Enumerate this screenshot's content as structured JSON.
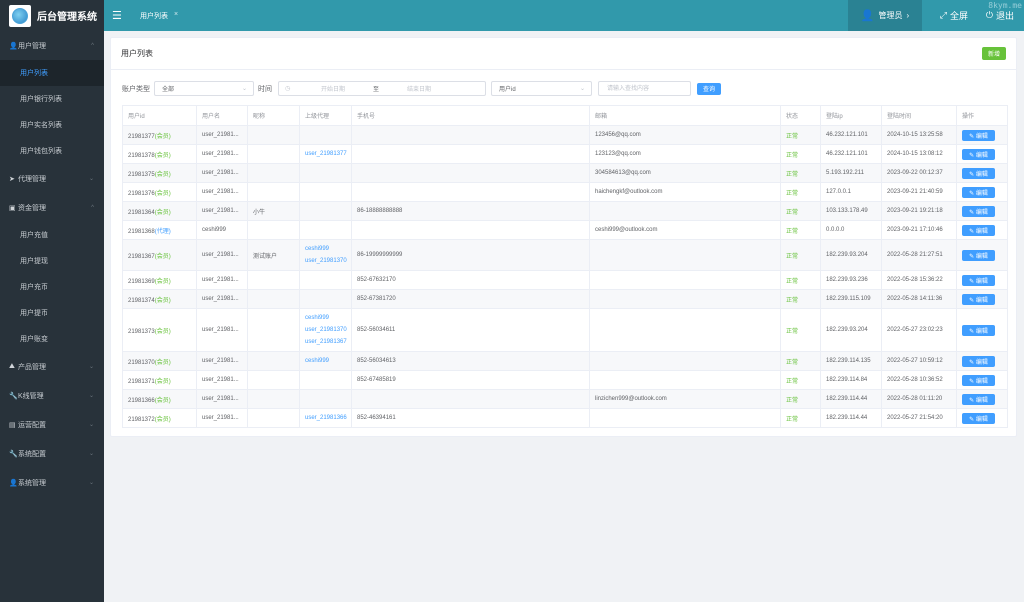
{
  "app": {
    "title": "后台管理系统",
    "watermark": "8kym.me"
  },
  "header": {
    "tab": "用户列表",
    "admin": "管理员",
    "fullscreen": "全屏",
    "logout": "退出"
  },
  "sidebar": [
    {
      "label": "用户管理",
      "icon": "user-icon",
      "expanded": true,
      "children": [
        {
          "label": "用户列表",
          "active": true
        },
        {
          "label": "用户银行列表"
        },
        {
          "label": "用户实名列表"
        },
        {
          "label": "用户钱包列表"
        }
      ]
    },
    {
      "label": "代理管理",
      "icon": "send-icon",
      "expanded": false,
      "children": []
    },
    {
      "label": "资金管理",
      "icon": "wallet-icon",
      "expanded": true,
      "children": [
        {
          "label": "用户充值"
        },
        {
          "label": "用户提现"
        },
        {
          "label": "用户充币"
        },
        {
          "label": "用户提币"
        },
        {
          "label": "用户账变"
        }
      ]
    },
    {
      "label": "产品管理",
      "icon": "chart-icon",
      "expanded": false,
      "children": []
    },
    {
      "label": "K线管理",
      "icon": "wrench-icon",
      "expanded": false,
      "children": []
    },
    {
      "label": "运营配置",
      "icon": "doc-icon",
      "expanded": false,
      "children": []
    },
    {
      "label": "系统配置",
      "icon": "wrench-icon",
      "expanded": false,
      "children": []
    },
    {
      "label": "系统管理",
      "icon": "user-gear-icon",
      "expanded": false,
      "children": []
    }
  ],
  "card": {
    "title": "用户列表",
    "add": "新增"
  },
  "filters": {
    "account_type_label": "账户类型",
    "account_type_value": "全部",
    "time_label": "时间",
    "start_placeholder": "开始日期",
    "range_sep": "至",
    "end_placeholder": "结束日期",
    "field_value": "用户id",
    "search_placeholder": "请输入查找内容",
    "query": "查询"
  },
  "table": {
    "columns": [
      "用户id",
      "用户名",
      "昵称",
      "上级代理",
      "手机号",
      "邮箱",
      "状态",
      "登陆ip",
      "登陆时间",
      "操作"
    ],
    "edit_label": "编辑",
    "rows": [
      {
        "id": "21981377",
        "type": "(会员)",
        "name": "user_21981...",
        "nick": "",
        "agents": [],
        "phone": "",
        "email": "123456@qq.com",
        "status": "正常",
        "ip": "46.232.121.101",
        "time": "2024-10-15 13:25:58"
      },
      {
        "id": "21981378",
        "type": "(会员)",
        "name": "user_21981...",
        "nick": "",
        "agents": [
          "user_21981377"
        ],
        "phone": "",
        "email": "123123@qq.com",
        "status": "正常",
        "ip": "46.232.121.101",
        "time": "2024-10-15 13:08:12"
      },
      {
        "id": "21981375",
        "type": "(会员)",
        "name": "user_21981...",
        "nick": "",
        "agents": [],
        "phone": "",
        "email": "304584613@qq.com",
        "status": "正常",
        "ip": "5.193.192.211",
        "time": "2023-09-22 00:12:37"
      },
      {
        "id": "21981376",
        "type": "(会员)",
        "name": "user_21981...",
        "nick": "",
        "agents": [],
        "phone": "",
        "email": "haichengkf@outlook.com",
        "status": "正常",
        "ip": "127.0.0.1",
        "time": "2023-09-21 21:40:59"
      },
      {
        "id": "21981364",
        "type": "(会员)",
        "name": "user_21981...",
        "nick": "小牛",
        "agents": [],
        "phone": "86-18888888888",
        "email": "",
        "status": "正常",
        "ip": "103.133.178.49",
        "time": "2023-09-21 19:21:18"
      },
      {
        "id": "21981368",
        "type": "(代理)",
        "name": "ceshi999",
        "nick": "",
        "agents": [],
        "phone": "",
        "email": "ceshi999@outlook.com",
        "status": "正常",
        "ip": "0.0.0.0",
        "time": "2023-09-21 17:10:46"
      },
      {
        "id": "21981367",
        "type": "(会员)",
        "name": "user_21981...",
        "nick": "测试账户",
        "agents": [
          "ceshi999",
          "user_21981370"
        ],
        "phone": "86-19999999999",
        "email": "",
        "status": "正常",
        "ip": "182.239.93.204",
        "time": "2022-05-28 21:27:51"
      },
      {
        "id": "21981369",
        "type": "(会员)",
        "name": "user_21981...",
        "nick": "",
        "agents": [],
        "phone": "852-67632170",
        "email": "",
        "status": "正常",
        "ip": "182.239.93.236",
        "time": "2022-05-28 15:36:22"
      },
      {
        "id": "21981374",
        "type": "(会员)",
        "name": "user_21981...",
        "nick": "",
        "agents": [],
        "phone": "852-67381720",
        "email": "",
        "status": "正常",
        "ip": "182.239.115.109",
        "time": "2022-05-28 14:11:36"
      },
      {
        "id": "21981373",
        "type": "(会员)",
        "name": "user_21981...",
        "nick": "",
        "agents": [
          "ceshi999",
          "user_21981370",
          "user_21981367"
        ],
        "phone": "852-56034611",
        "email": "",
        "status": "正常",
        "ip": "182.239.93.204",
        "time": "2022-05-27 23:02:23"
      },
      {
        "id": "21981370",
        "type": "(会员)",
        "name": "user_21981...",
        "nick": "",
        "agents": [
          "ceshi999"
        ],
        "phone": "852-56034613",
        "email": "",
        "status": "正常",
        "ip": "182.239.114.135",
        "time": "2022-05-27 10:59:12"
      },
      {
        "id": "21981371",
        "type": "(会员)",
        "name": "user_21981...",
        "nick": "",
        "agents": [],
        "phone": "852-67485819",
        "email": "",
        "status": "正常",
        "ip": "182.239.114.84",
        "time": "2022-05-28 10:36:52"
      },
      {
        "id": "21981366",
        "type": "(会员)",
        "name": "user_21981...",
        "nick": "",
        "agents": [],
        "phone": "",
        "email": "linzichen999@outlook.com",
        "status": "正常",
        "ip": "182.239.114.44",
        "time": "2022-05-28 01:11:20"
      },
      {
        "id": "21981372",
        "type": "(会员)",
        "name": "user_21981...",
        "nick": "",
        "agents": [
          "user_21981366"
        ],
        "phone": "852-46394161",
        "email": "",
        "status": "正常",
        "ip": "182.239.114.44",
        "time": "2022-05-27 21:54:20"
      }
    ]
  },
  "colors": {
    "sidebar": "#28323a",
    "header": "#3199ab",
    "primary": "#409eff",
    "success": "#67c23a"
  }
}
